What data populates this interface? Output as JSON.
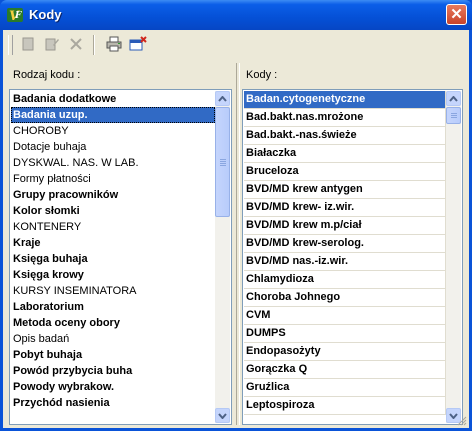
{
  "window": {
    "title": "Kody",
    "close_glyph": "✕"
  },
  "toolbar": {
    "buttons": [
      {
        "name": "new-record-button",
        "icon": "new-document-icon",
        "enabled": false
      },
      {
        "name": "edit-record-button",
        "icon": "edit-icon",
        "enabled": false
      },
      {
        "name": "delete-record-button",
        "icon": "delete-x-icon",
        "enabled": false
      },
      {
        "name": "print-button",
        "icon": "printer-icon",
        "enabled": true
      },
      {
        "name": "close-window-button",
        "icon": "close-window-icon",
        "enabled": true
      }
    ]
  },
  "left_panel": {
    "label": "Rodzaj kodu :",
    "items": [
      {
        "label": "Badania dodatkowe",
        "bold": true
      },
      {
        "label": "Badania uzup.",
        "bold": true,
        "selected": true
      },
      {
        "label": "CHOROBY",
        "bold": false
      },
      {
        "label": "Dotacje buhaja",
        "bold": false
      },
      {
        "label": "DYSKWAL. NAS. W LAB.",
        "bold": false
      },
      {
        "label": "Formy płatności",
        "bold": false
      },
      {
        "label": "Grupy pracowników",
        "bold": true
      },
      {
        "label": "Kolor słomki",
        "bold": true
      },
      {
        "label": "KONTENERY",
        "bold": false
      },
      {
        "label": "Kraje",
        "bold": true
      },
      {
        "label": "Księga buhaja",
        "bold": true
      },
      {
        "label": "Księga krowy",
        "bold": true
      },
      {
        "label": "KURSY INSEMINATORA",
        "bold": false
      },
      {
        "label": "Laboratorium",
        "bold": true
      },
      {
        "label": "Metoda oceny obory",
        "bold": true
      },
      {
        "label": "Opis badań",
        "bold": false
      },
      {
        "label": "Pobyt buhaja",
        "bold": true
      },
      {
        "label": "Powód przybycia buha",
        "bold": true
      },
      {
        "label": "Powody wybrakow.",
        "bold": true
      },
      {
        "label": "Przychód nasienia",
        "bold": true
      }
    ]
  },
  "right_panel": {
    "label": "Kody :",
    "items": [
      {
        "label": "Badan.cytogenetyczne",
        "selected": true
      },
      {
        "label": "Bad.bakt.nas.mrożone"
      },
      {
        "label": "Bad.bakt.-nas.świeże"
      },
      {
        "label": "Białaczka"
      },
      {
        "label": "Bruceloza"
      },
      {
        "label": "BVD/MD krew antygen"
      },
      {
        "label": "BVD/MD krew- iz.wir."
      },
      {
        "label": "BVD/MD krew m.p/ciał"
      },
      {
        "label": "BVD/MD krew-serolog."
      },
      {
        "label": "BVD/MD nas.-iz.wir."
      },
      {
        "label": "Chlamydioza"
      },
      {
        "label": "Choroba Johnego"
      },
      {
        "label": "CVM"
      },
      {
        "label": "DUMPS"
      },
      {
        "label": "Endopasożyty"
      },
      {
        "label": "Gorączka Q"
      },
      {
        "label": "Gruźlica"
      },
      {
        "label": "Leptospiroza"
      }
    ]
  },
  "colors": {
    "titlebar": "#0550d6",
    "selection": "#316ac5",
    "dialog_bg": "#ece9d8",
    "list_border": "#7f9db9"
  }
}
